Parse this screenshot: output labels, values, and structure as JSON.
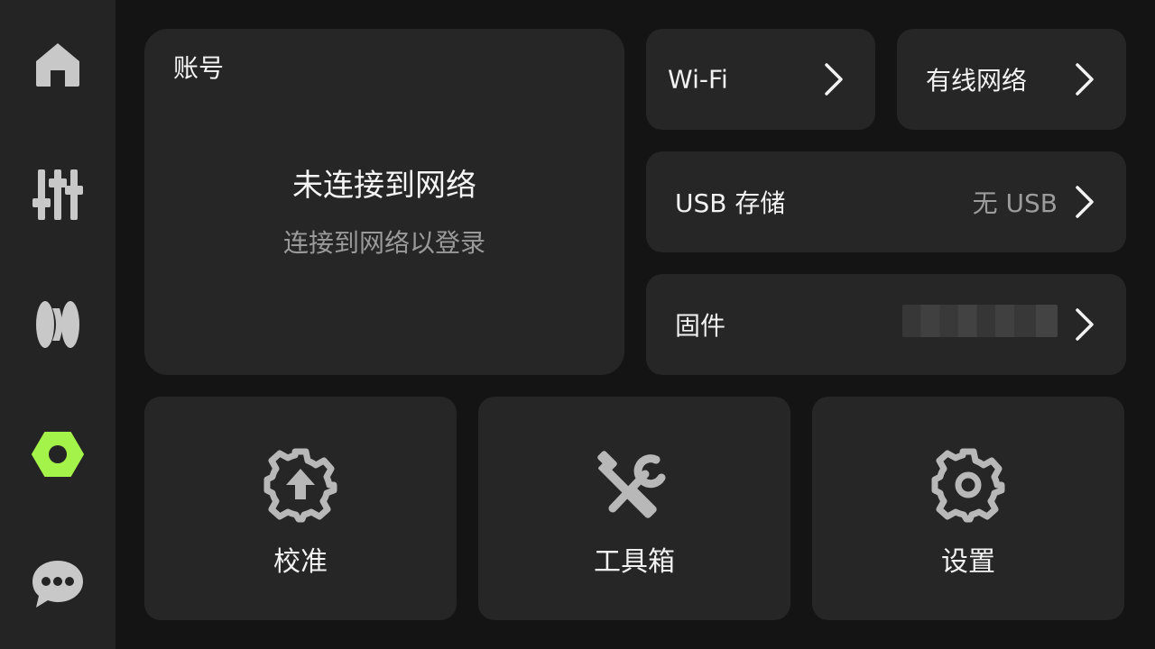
{
  "sidebar": {
    "active_color": "#a4f34a",
    "icon_color": "#cfcfcf",
    "items": [
      {
        "name": "home",
        "icon": "home-icon"
      },
      {
        "name": "controls",
        "icon": "sliders-icon"
      },
      {
        "name": "filament",
        "icon": "filament-spool-icon"
      },
      {
        "name": "settings",
        "icon": "hex-nut-icon",
        "active": true
      },
      {
        "name": "messages",
        "icon": "chat-bubble-icon"
      }
    ]
  },
  "account": {
    "title": "账号",
    "status": "未连接到网络",
    "hint": "连接到网络以登录"
  },
  "network": {
    "wifi_label": "Wi-Fi",
    "wired_label": "有线网络"
  },
  "usb": {
    "label": "USB 存储",
    "value": "无 USB"
  },
  "firmware": {
    "label": "固件"
  },
  "tools": [
    {
      "label": "校准",
      "icon": "gear-upload-icon"
    },
    {
      "label": "工具箱",
      "icon": "screwdriver-wrench-icon"
    },
    {
      "label": "设置",
      "icon": "gear-icon"
    }
  ]
}
